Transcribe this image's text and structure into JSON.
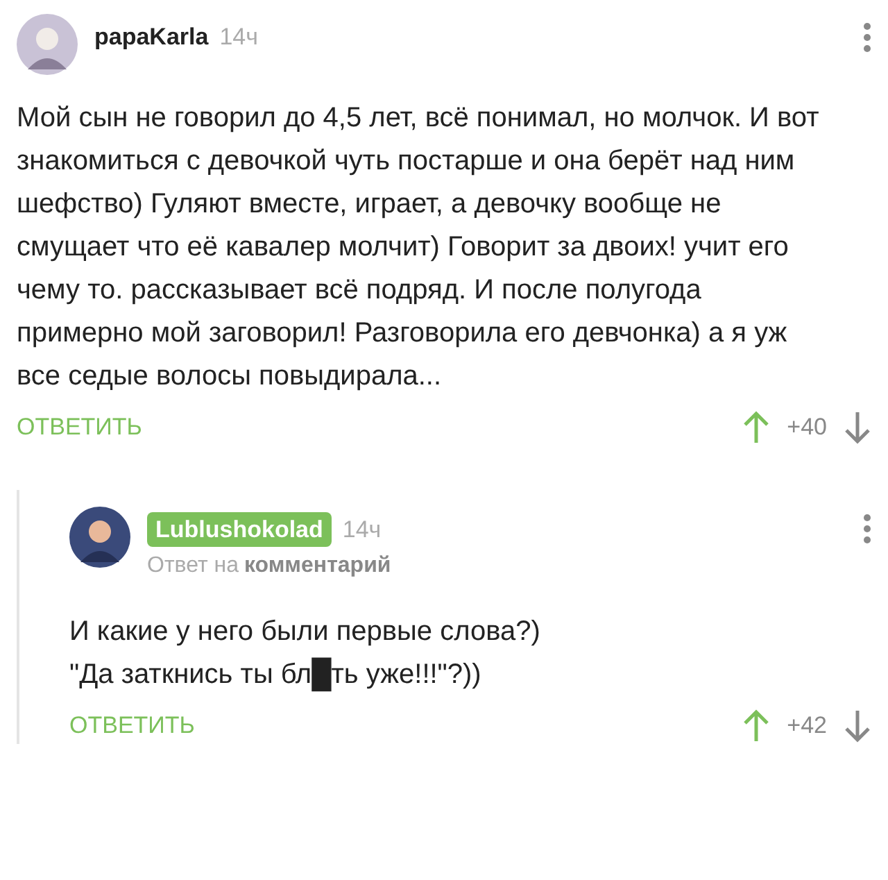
{
  "comments": [
    {
      "author": "papaKarla",
      "highlighted": false,
      "time": "14ч",
      "text": [
        "Мой сын не говорил до 4,5 лет, всё понимал, но молчок. И вот знакомиться с девочкой чуть постарше и она берёт над ним шефство) Гуляют вместе, играет, а девочку вообще не смущает что её кавалер молчит) Говорит за двоих! учит его чему то. рассказывает всё подряд. И после полугода примерно мой заговорил! Разговорила его девчонка) а я уж все седые волосы повыдирала..."
      ],
      "reply_label": "ОТВЕТИТЬ",
      "score": "+40",
      "nested": false
    },
    {
      "author": "Lublushokolad",
      "highlighted": true,
      "time": "14ч",
      "reply_to": {
        "prefix": "Ответ на",
        "target": "комментарий"
      },
      "text": [
        "И какие у него были первые слова?)",
        "\"Да заткнись ты бл█ть уже!!!\"?))"
      ],
      "reply_label": "ОТВЕТИТЬ",
      "score": "+42",
      "nested": true
    }
  ]
}
